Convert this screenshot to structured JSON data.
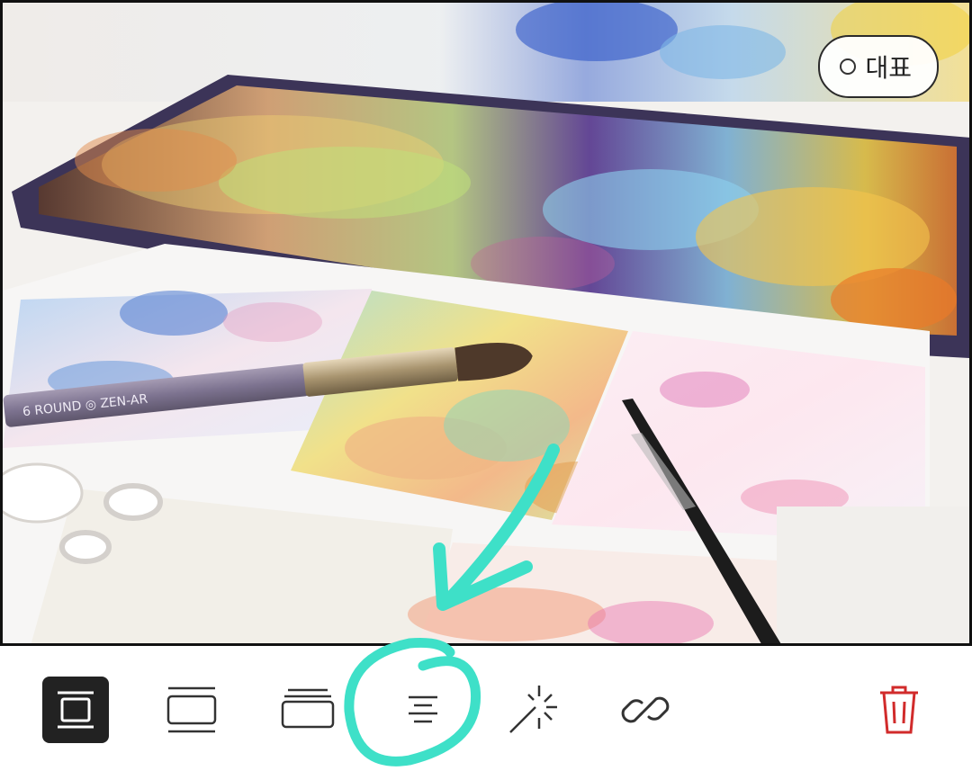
{
  "photo": {
    "representative_label": "대표",
    "brush_text": "6 ROUND ◎ ZEN-AR"
  },
  "toolbar": {
    "items": [
      {
        "name": "frame-full",
        "icon": "frame-full-icon",
        "active": true
      },
      {
        "name": "frame-wide",
        "icon": "frame-wide-icon",
        "active": false
      },
      {
        "name": "frame-stack",
        "icon": "frame-stack-icon",
        "active": false
      },
      {
        "name": "align-center",
        "icon": "align-center-icon",
        "active": false
      },
      {
        "name": "magic",
        "icon": "magic-wand-icon",
        "active": false
      },
      {
        "name": "link",
        "icon": "link-icon",
        "active": false
      },
      {
        "name": "delete",
        "icon": "trash-icon",
        "active": false
      }
    ]
  },
  "colors": {
    "accent_annotation": "#3ee0c8",
    "delete": "#d12b2b",
    "active_bg": "#222222"
  }
}
